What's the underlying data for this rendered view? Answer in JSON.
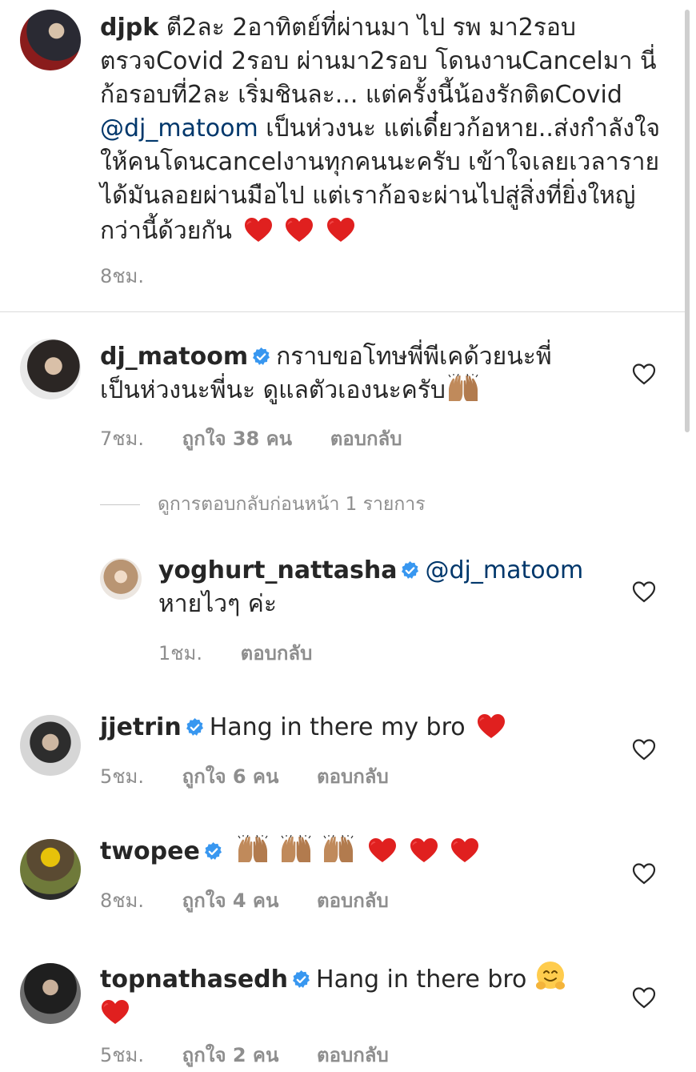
{
  "caption": {
    "username": "djpk",
    "lines": [
      "ตี2ละ 2อาทิตย์ที่ผ่านมา ไป รพ มา2รอบ",
      "ตรวจCovid 2รอบ ผ่านมา2รอบ โดนงานCancelมา นี่",
      "ก้อรอบที่2ละ  เริ่มชินละ... แต่ครั้งนี้น้องรักติดCovid",
      "เป็นห่วงนะ แต่เดี๋ยวก้อหาย..ส่งกำลังใจ",
      "ให้คนโดนcancelงานทุกคนนะครับ เข้าใจเลยเวลาราย",
      "ได้มันลอยผ่านมือไป แต่เราก้อจะผ่านไปสู่สิ่งที่ยิ่งใหญ่",
      "กว่านี้ด้วยกัน"
    ],
    "line4_mention": "@dj_matoom",
    "time": "8ชม."
  },
  "comments": [
    {
      "username": "dj_matoom",
      "text_line1": "กราบขอโทษพี่พีเคด้วยนะพี่",
      "text_line2": "เป็นห่วงนะพี่นะ ดูแลตัวเองนะครับ",
      "time": "7ชม.",
      "likes": "ถูกใจ 38 คน",
      "reply": "ตอบกลับ"
    },
    {
      "username": "jjetrin",
      "text": "Hang in there my bro",
      "time": "5ชม.",
      "likes": "ถูกใจ 6 คน",
      "reply": "ตอบกลับ"
    },
    {
      "username": "twopee",
      "time": "8ชม.",
      "likes": "ถูกใจ 4 คน",
      "reply": "ตอบกลับ"
    },
    {
      "username": "topnathasedh",
      "text": "Hang in there bro",
      "time": "5ชม.",
      "likes": "ถูกใจ 2 คน",
      "reply": "ตอบกลับ"
    }
  ],
  "view_previous_replies": "ดูการตอบกลับก่อนหน้า 1 รายการ",
  "reply": {
    "username": "yoghurt_nattasha",
    "mention": "@dj_matoom",
    "text": "หายไวๆ ค่ะ",
    "time": "1ชม.",
    "reply_label": "ตอบกลับ"
  },
  "colors": {
    "verified": "#3897f0",
    "mention": "#00376b",
    "heart_red": "#e0201f",
    "meta_gray": "#8e8e8e"
  },
  "icons": [
    "verified-badge-icon",
    "heart-outline-icon",
    "red-heart-emoji",
    "praise-hands-emoji",
    "hugging-face-emoji"
  ]
}
